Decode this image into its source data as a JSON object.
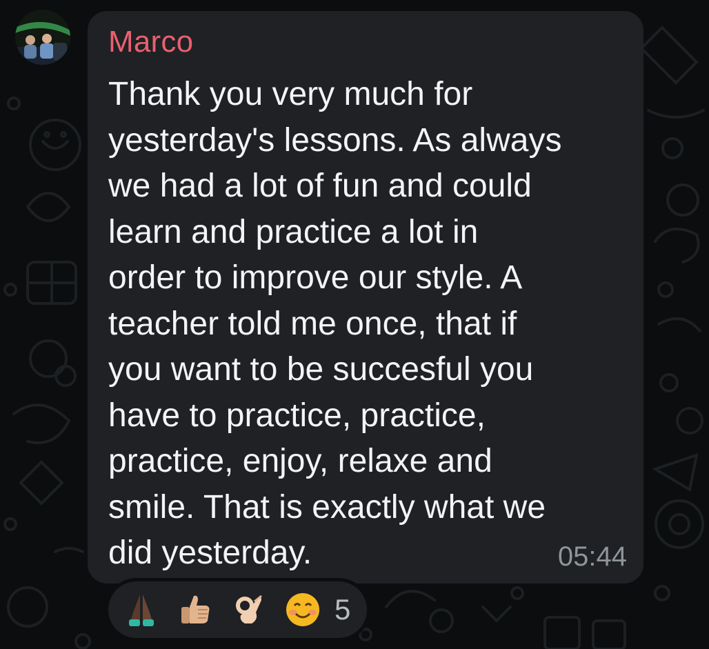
{
  "message": {
    "sender": "Marco",
    "text_lines": [
      "Thank you very much for",
      "yesterday's lessons. As always",
      "we had a lot of fun and could",
      "learn and practice a lot in",
      "order to improve our style. A",
      "teacher told me once, that if",
      "you want to be succesful you",
      "have to practice, practice,",
      "practice, enjoy, relaxe and",
      "smile. That is exactly what we",
      "did yesterday."
    ],
    "timestamp": "05:44"
  },
  "reactions": {
    "emojis": [
      "folded-hands-icon",
      "thumbs-up-icon",
      "ok-hand-icon",
      "smiling-face-icon"
    ],
    "count": "5"
  },
  "colors": {
    "sender_name": "#e8606f",
    "bubble": "#1f2124",
    "background": "#0b0d0e",
    "text": "#f3f4f5",
    "timestamp": "#8f9599"
  }
}
